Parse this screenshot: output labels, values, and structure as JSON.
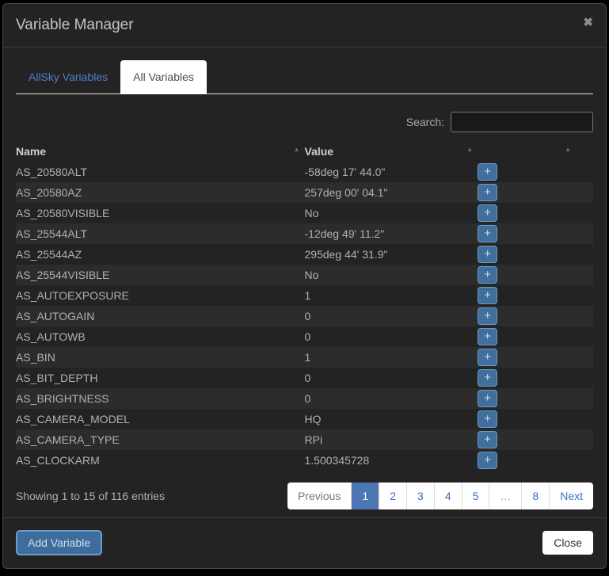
{
  "modal": {
    "title": "Variable Manager",
    "close_icon": "✖"
  },
  "tabs": [
    {
      "label": "AllSky Variables",
      "active": false
    },
    {
      "label": "All Variables",
      "active": true
    }
  ],
  "search": {
    "label": "Search:",
    "value": "",
    "placeholder": ""
  },
  "table": {
    "columns": [
      "Name",
      "Value"
    ],
    "sort_icon": "▲",
    "add_button_label": "+",
    "rows": [
      {
        "name": "AS_20580ALT",
        "value": "-58deg 17' 44.0\""
      },
      {
        "name": "AS_20580AZ",
        "value": "257deg 00' 04.1\""
      },
      {
        "name": "AS_20580VISIBLE",
        "value": "No"
      },
      {
        "name": "AS_25544ALT",
        "value": "-12deg 49' 11.2\""
      },
      {
        "name": "AS_25544AZ",
        "value": "295deg 44' 31.9\""
      },
      {
        "name": "AS_25544VISIBLE",
        "value": "No"
      },
      {
        "name": "AS_AUTOEXPOSURE",
        "value": "1"
      },
      {
        "name": "AS_AUTOGAIN",
        "value": "0"
      },
      {
        "name": "AS_AUTOWB",
        "value": "0"
      },
      {
        "name": "AS_BIN",
        "value": "1"
      },
      {
        "name": "AS_BIT_DEPTH",
        "value": "0"
      },
      {
        "name": "AS_BRIGHTNESS",
        "value": "0"
      },
      {
        "name": "AS_CAMERA_MODEL",
        "value": "HQ"
      },
      {
        "name": "AS_CAMERA_TYPE",
        "value": "RPi"
      },
      {
        "name": "AS_CLOCKARM",
        "value": "1.500345728"
      }
    ]
  },
  "summary": "Showing 1 to 15 of 116 entries",
  "pagination": {
    "items": [
      {
        "label": "Previous",
        "type": "prev"
      },
      {
        "label": "1",
        "type": "active"
      },
      {
        "label": "2",
        "type": "page"
      },
      {
        "label": "3",
        "type": "page"
      },
      {
        "label": "4",
        "type": "page"
      },
      {
        "label": "5",
        "type": "page"
      },
      {
        "label": "…",
        "type": "ellipsis"
      },
      {
        "label": "8",
        "type": "page"
      },
      {
        "label": "Next",
        "type": "next"
      }
    ]
  },
  "footer": {
    "add_variable_label": "Add Variable",
    "close_label": "Close"
  },
  "colors": {
    "accent_blue": "#406f9e",
    "active_page_blue": "#4c76b4",
    "link_blue": "#4d80c4",
    "modal_background": "#232323"
  }
}
